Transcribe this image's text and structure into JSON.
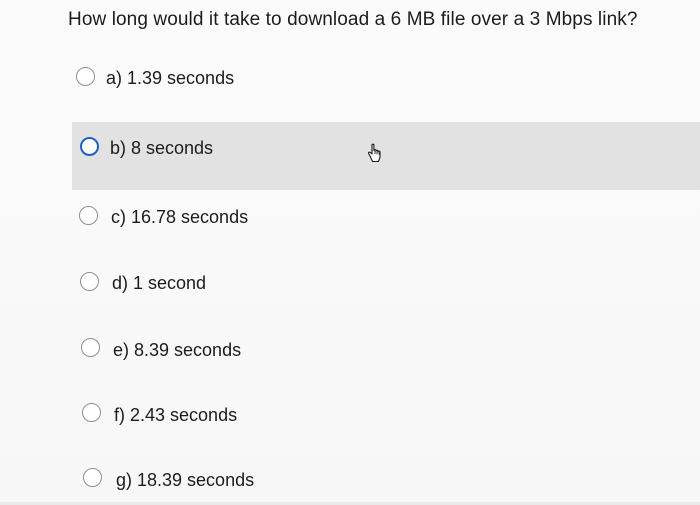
{
  "question": {
    "text": "How long would it take to download a 6 MB file over a 3 Mbps link?"
  },
  "options": [
    {
      "label": "a)  1.39 seconds"
    },
    {
      "label": "b)  8 seconds"
    },
    {
      "label": "c)  16.78 seconds"
    },
    {
      "label": "d)  1 second"
    },
    {
      "label": "e)  8.39 seconds"
    },
    {
      "label": "f)  2.43 seconds"
    },
    {
      "label": "g)  18.39 seconds"
    }
  ],
  "colors": {
    "hover_row": "#e2e2e2",
    "radio_focus": "#1f5fc2",
    "radio_border": "#8f8f8f"
  },
  "icons": {
    "cursor": "hand-pointer-icon"
  }
}
